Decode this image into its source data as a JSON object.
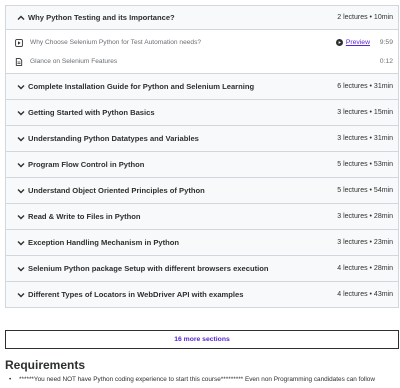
{
  "curriculum": {
    "sections": [
      {
        "title": "Why Python Testing and its Importance?",
        "meta": "2 lectures • 10min",
        "expanded": true
      },
      {
        "title": "Complete Installation Guide for Python and Selenium Learning",
        "meta": "6 lectures • 31min"
      },
      {
        "title": "Getting Started with Python Basics",
        "meta": "3 lectures • 15min"
      },
      {
        "title": "Understanding Python Datatypes and Variables",
        "meta": "3 lectures • 31min"
      },
      {
        "title": "Program Flow Control in Python",
        "meta": "5 lectures • 53min"
      },
      {
        "title": "Understand Object Oriented Principles of Python",
        "meta": "5 lectures • 54min"
      },
      {
        "title": "Read & Write to Files in Python",
        "meta": "3 lectures • 28min"
      },
      {
        "title": "Exception Handling Mechanism in Python",
        "meta": "3 lectures • 23min"
      },
      {
        "title": "Selenium Python package Setup with different browsers execution",
        "meta": "4 lectures • 28min"
      },
      {
        "title": "Different Types of Locators in WebDriver API with examples",
        "meta": "4 lectures • 43min"
      }
    ],
    "lessons": [
      {
        "title": "Why Choose Selenium Python for Test Automation needs?",
        "preview": "Preview",
        "time": "9:59",
        "icon": "video-icon"
      },
      {
        "title": "Glance on Selenium Features",
        "time": "0:12",
        "icon": "file-icon"
      }
    ],
    "more_sections": "16 more sections"
  },
  "requirements": {
    "heading": "Requirements",
    "items": [
      "******You need NOT have Python coding experience to start this course********* Even non Programming candidates can follow"
    ]
  }
}
